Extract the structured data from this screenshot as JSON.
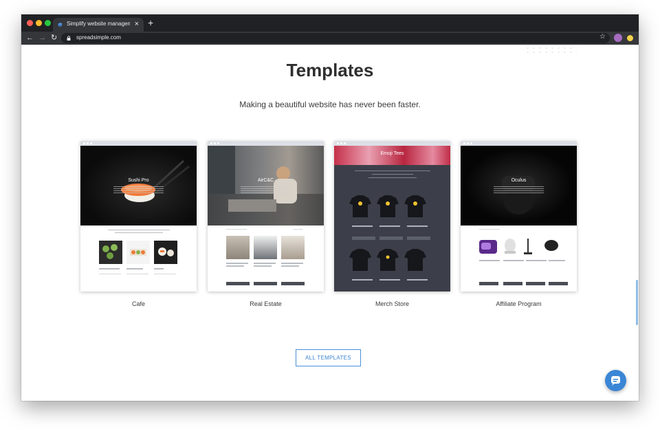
{
  "browser": {
    "tab_title": "Simplify website management",
    "url": "spreadsimple.com"
  },
  "page": {
    "title": "Templates",
    "subtitle": "Making a beautiful website has never been faster.",
    "all_templates_label": "ALL TEMPLATES"
  },
  "templates": [
    {
      "caption": "Cafe",
      "hero_title": "Sushi Pro"
    },
    {
      "caption": "Real Estate",
      "hero_title": "AirC&C"
    },
    {
      "caption": "Merch Store",
      "hero_title": "Emoji Tees"
    },
    {
      "caption": "Affiliate Program",
      "hero_title": "Oculus"
    }
  ],
  "colors": {
    "accent": "#3d84cf",
    "chat_button": "#3a86d6",
    "browser_dark": "#202124"
  },
  "icons": {
    "back": "arrow-left-icon",
    "forward": "arrow-right-icon",
    "reload": "reload-icon",
    "bookmark": "star-icon",
    "chat": "chat-bubble-icon"
  }
}
